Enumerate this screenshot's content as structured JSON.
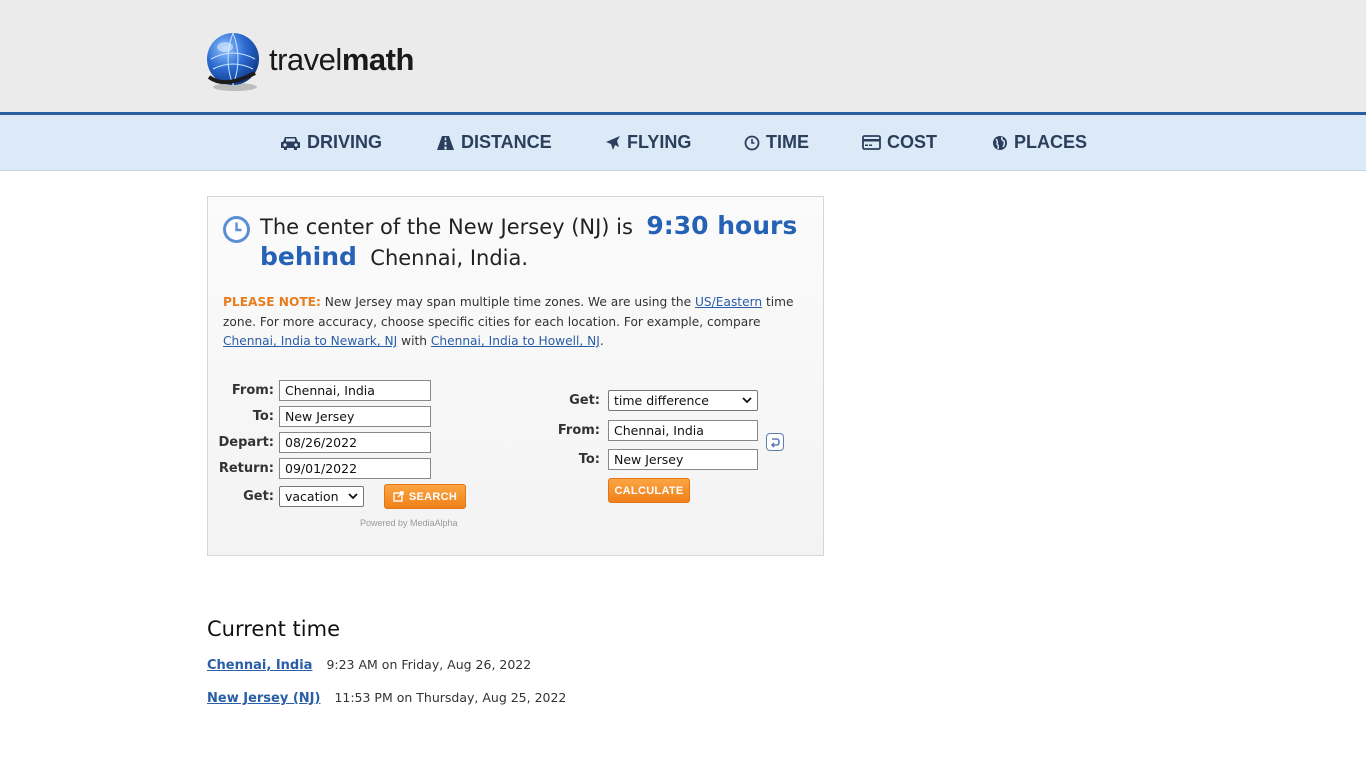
{
  "logo": {
    "brand_a": "travel",
    "brand_b": "math"
  },
  "nav": [
    {
      "label": "DRIVING",
      "icon": "car-icon"
    },
    {
      "label": "DISTANCE",
      "icon": "road-icon"
    },
    {
      "label": "FLYING",
      "icon": "plane-icon"
    },
    {
      "label": "TIME",
      "icon": "clock-icon"
    },
    {
      "label": "COST",
      "icon": "credit-card-icon"
    },
    {
      "label": "PLACES",
      "icon": "globe-icon"
    }
  ],
  "headline": {
    "prefix": "The center of the New Jersey (NJ) is",
    "highlight": "9:30 hours behind",
    "suffix": "Chennai, India."
  },
  "note": {
    "label": "PLEASE NOTE:",
    "t1": "New Jersey may span multiple time zones. We are using the",
    "link_tz": "US/Eastern",
    "t2": "time zone. For more accuracy, choose specific cities for each location. For example, compare",
    "link_a": "Chennai, India to Newark, NJ",
    "t3": "with",
    "link_b": "Chennai, India to Howell, NJ",
    "t4": "."
  },
  "left_form": {
    "from_label": "From:",
    "from_value": "Chennai, India",
    "to_label": "To:",
    "to_value": "New Jersey",
    "depart_label": "Depart:",
    "depart_value": "08/26/2022",
    "return_label": "Return:",
    "return_value": "09/01/2022",
    "get_label": "Get:",
    "get_value": "vacation",
    "search_label": "SEARCH",
    "powered": "Powered by MediaAlpha"
  },
  "right_form": {
    "get_label": "Get:",
    "get_value": "time difference",
    "from_label": "From:",
    "from_value": "Chennai, India",
    "to_label": "To:",
    "to_value": "New Jersey",
    "calc_label": "CALCULATE"
  },
  "current_time": {
    "title": "Current time",
    "rows": [
      {
        "place": "Chennai, India",
        "time": "9:23 AM on Friday, Aug 26, 2022"
      },
      {
        "place": "New Jersey (NJ)",
        "time": "11:53 PM on Thursday, Aug 25, 2022"
      }
    ]
  },
  "colors": {
    "accent": "#2562b5",
    "nav_bg": "#dce9f7",
    "orange": "#f0801a",
    "warn": "#e87d1e"
  }
}
